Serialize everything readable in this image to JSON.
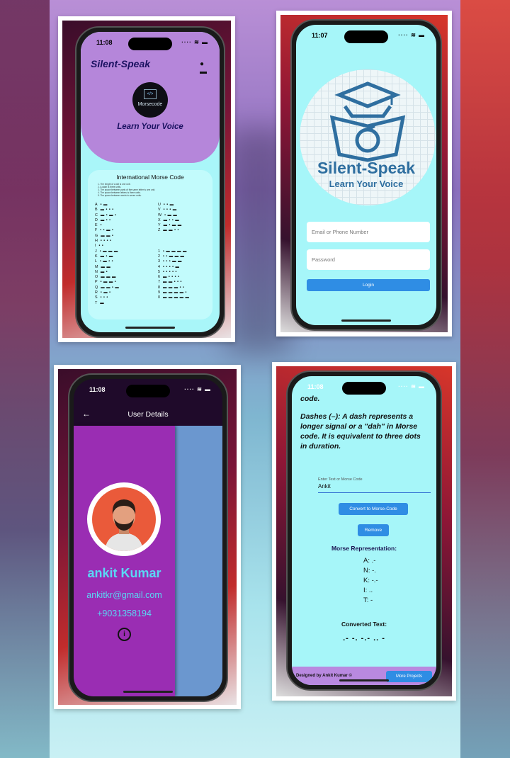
{
  "status": {
    "time_1": "11:08",
    "time_2": "11:07",
    "time_3": "11:08",
    "time_4": "11:08",
    "signal": "···· ≋ ▬"
  },
  "home": {
    "app_title": "Silent-Speak",
    "logo_label": "Morsecode",
    "logo_glyph": "</>",
    "tagline": "Learn Your Voice",
    "chart_title": "International Morse Code",
    "rules": [
      "1. The length of a dot is one unit.",
      "2. A dash is three units.",
      "3. The space between parts of the same letter is one unit.",
      "4. The space between letters is three units.",
      "5. The space between words is seven units."
    ],
    "letters_left": [
      {
        "ch": "A",
        "code": "• ▬"
      },
      {
        "ch": "B",
        "code": "▬ • • •"
      },
      {
        "ch": "C",
        "code": "▬ • ▬ •"
      },
      {
        "ch": "D",
        "code": "▬ • •"
      },
      {
        "ch": "E",
        "code": "•"
      },
      {
        "ch": "F",
        "code": "• • ▬ •"
      },
      {
        "ch": "G",
        "code": "▬ ▬ •"
      },
      {
        "ch": "H",
        "code": "• • • •"
      },
      {
        "ch": "I",
        "code": "• •"
      },
      {
        "ch": "J",
        "code": "• ▬ ▬ ▬"
      },
      {
        "ch": "K",
        "code": "▬ • ▬"
      },
      {
        "ch": "L",
        "code": "• ▬ • •"
      },
      {
        "ch": "M",
        "code": "▬ ▬"
      },
      {
        "ch": "N",
        "code": "▬ •"
      },
      {
        "ch": "O",
        "code": "▬ ▬ ▬"
      },
      {
        "ch": "P",
        "code": "• ▬ ▬ •"
      },
      {
        "ch": "Q",
        "code": "▬ ▬ • ▬"
      },
      {
        "ch": "R",
        "code": "• ▬ •"
      },
      {
        "ch": "S",
        "code": "• • •"
      },
      {
        "ch": "T",
        "code": "▬"
      }
    ],
    "letters_right": [
      {
        "ch": "U",
        "code": "• • ▬"
      },
      {
        "ch": "V",
        "code": "• • • ▬"
      },
      {
        "ch": "W",
        "code": "• ▬ ▬"
      },
      {
        "ch": "X",
        "code": "▬ • • ▬"
      },
      {
        "ch": "Y",
        "code": "▬ • ▬ ▬"
      },
      {
        "ch": "Z",
        "code": "▬ ▬ • •"
      },
      {
        "ch": "",
        "code": ""
      },
      {
        "ch": "",
        "code": ""
      },
      {
        "ch": "",
        "code": ""
      },
      {
        "ch": "1",
        "code": "• ▬ ▬ ▬ ▬"
      },
      {
        "ch": "2",
        "code": "• • ▬ ▬ ▬"
      },
      {
        "ch": "3",
        "code": "• • • ▬ ▬"
      },
      {
        "ch": "4",
        "code": "• • • • ▬"
      },
      {
        "ch": "5",
        "code": "• • • • •"
      },
      {
        "ch": "6",
        "code": "▬ • • • •"
      },
      {
        "ch": "7",
        "code": "▬ ▬ • • •"
      },
      {
        "ch": "8",
        "code": "▬ ▬ ▬ • •"
      },
      {
        "ch": "9",
        "code": "▬ ▬ ▬ ▬ •"
      },
      {
        "ch": "0",
        "code": "▬ ▬ ▬ ▬ ▬"
      },
      {
        "ch": "",
        "code": ""
      }
    ]
  },
  "login": {
    "brand": "Silent-Speak",
    "brand_sub": "Learn Your Voice",
    "email_placeholder": "Email or Phone Number",
    "password_placeholder": "Password",
    "login_label": "Login"
  },
  "user": {
    "title": "User Details",
    "back_icon": "←",
    "name": "ankit Kumar",
    "email": "ankitkr@gmail.com",
    "phone": "+9031358194",
    "info_icon": "i"
  },
  "converter": {
    "text_top": "code.",
    "paragraph": "Dashes (–): A dash represents a longer signal or a \"dah\" in Morse code. It is equivalent to three dots in duration.",
    "field_label": "Enter Text or Morse Code",
    "field_value": "Ankit",
    "convert_label": "Convert to Morse-Code",
    "remove_label": "Remove",
    "morse_title": "Morse Representation:",
    "morse_lines": [
      "A: .-",
      "N: -.",
      "K: -.-",
      "I: ..",
      "T: -"
    ],
    "converted_title": "Converted Text:",
    "converted_value": ".- -. -.- .. -",
    "footer_text": "Designed by Ankit Kumar ©",
    "footer_button": "More Projects"
  },
  "colors": {
    "accent": "#2f8de4",
    "purple": "#b586da",
    "cyan": "#a6f6f9",
    "drawer": "#9a2db3",
    "brand_blue": "#2f6fa0"
  }
}
